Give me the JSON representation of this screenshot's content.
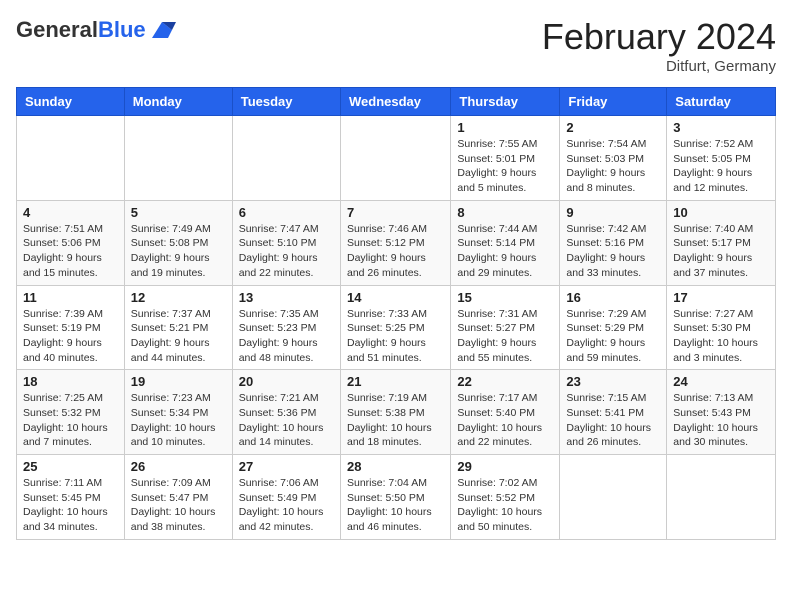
{
  "header": {
    "logo_general": "General",
    "logo_blue": "Blue",
    "month_title": "February 2024",
    "location": "Ditfurt, Germany"
  },
  "days_of_week": [
    "Sunday",
    "Monday",
    "Tuesday",
    "Wednesday",
    "Thursday",
    "Friday",
    "Saturday"
  ],
  "weeks": [
    [
      {
        "num": "",
        "info": ""
      },
      {
        "num": "",
        "info": ""
      },
      {
        "num": "",
        "info": ""
      },
      {
        "num": "",
        "info": ""
      },
      {
        "num": "1",
        "info": "Sunrise: 7:55 AM\nSunset: 5:01 PM\nDaylight: 9 hours and 5 minutes."
      },
      {
        "num": "2",
        "info": "Sunrise: 7:54 AM\nSunset: 5:03 PM\nDaylight: 9 hours and 8 minutes."
      },
      {
        "num": "3",
        "info": "Sunrise: 7:52 AM\nSunset: 5:05 PM\nDaylight: 9 hours and 12 minutes."
      }
    ],
    [
      {
        "num": "4",
        "info": "Sunrise: 7:51 AM\nSunset: 5:06 PM\nDaylight: 9 hours and 15 minutes."
      },
      {
        "num": "5",
        "info": "Sunrise: 7:49 AM\nSunset: 5:08 PM\nDaylight: 9 hours and 19 minutes."
      },
      {
        "num": "6",
        "info": "Sunrise: 7:47 AM\nSunset: 5:10 PM\nDaylight: 9 hours and 22 minutes."
      },
      {
        "num": "7",
        "info": "Sunrise: 7:46 AM\nSunset: 5:12 PM\nDaylight: 9 hours and 26 minutes."
      },
      {
        "num": "8",
        "info": "Sunrise: 7:44 AM\nSunset: 5:14 PM\nDaylight: 9 hours and 29 minutes."
      },
      {
        "num": "9",
        "info": "Sunrise: 7:42 AM\nSunset: 5:16 PM\nDaylight: 9 hours and 33 minutes."
      },
      {
        "num": "10",
        "info": "Sunrise: 7:40 AM\nSunset: 5:17 PM\nDaylight: 9 hours and 37 minutes."
      }
    ],
    [
      {
        "num": "11",
        "info": "Sunrise: 7:39 AM\nSunset: 5:19 PM\nDaylight: 9 hours and 40 minutes."
      },
      {
        "num": "12",
        "info": "Sunrise: 7:37 AM\nSunset: 5:21 PM\nDaylight: 9 hours and 44 minutes."
      },
      {
        "num": "13",
        "info": "Sunrise: 7:35 AM\nSunset: 5:23 PM\nDaylight: 9 hours and 48 minutes."
      },
      {
        "num": "14",
        "info": "Sunrise: 7:33 AM\nSunset: 5:25 PM\nDaylight: 9 hours and 51 minutes."
      },
      {
        "num": "15",
        "info": "Sunrise: 7:31 AM\nSunset: 5:27 PM\nDaylight: 9 hours and 55 minutes."
      },
      {
        "num": "16",
        "info": "Sunrise: 7:29 AM\nSunset: 5:29 PM\nDaylight: 9 hours and 59 minutes."
      },
      {
        "num": "17",
        "info": "Sunrise: 7:27 AM\nSunset: 5:30 PM\nDaylight: 10 hours and 3 minutes."
      }
    ],
    [
      {
        "num": "18",
        "info": "Sunrise: 7:25 AM\nSunset: 5:32 PM\nDaylight: 10 hours and 7 minutes."
      },
      {
        "num": "19",
        "info": "Sunrise: 7:23 AM\nSunset: 5:34 PM\nDaylight: 10 hours and 10 minutes."
      },
      {
        "num": "20",
        "info": "Sunrise: 7:21 AM\nSunset: 5:36 PM\nDaylight: 10 hours and 14 minutes."
      },
      {
        "num": "21",
        "info": "Sunrise: 7:19 AM\nSunset: 5:38 PM\nDaylight: 10 hours and 18 minutes."
      },
      {
        "num": "22",
        "info": "Sunrise: 7:17 AM\nSunset: 5:40 PM\nDaylight: 10 hours and 22 minutes."
      },
      {
        "num": "23",
        "info": "Sunrise: 7:15 AM\nSunset: 5:41 PM\nDaylight: 10 hours and 26 minutes."
      },
      {
        "num": "24",
        "info": "Sunrise: 7:13 AM\nSunset: 5:43 PM\nDaylight: 10 hours and 30 minutes."
      }
    ],
    [
      {
        "num": "25",
        "info": "Sunrise: 7:11 AM\nSunset: 5:45 PM\nDaylight: 10 hours and 34 minutes."
      },
      {
        "num": "26",
        "info": "Sunrise: 7:09 AM\nSunset: 5:47 PM\nDaylight: 10 hours and 38 minutes."
      },
      {
        "num": "27",
        "info": "Sunrise: 7:06 AM\nSunset: 5:49 PM\nDaylight: 10 hours and 42 minutes."
      },
      {
        "num": "28",
        "info": "Sunrise: 7:04 AM\nSunset: 5:50 PM\nDaylight: 10 hours and 46 minutes."
      },
      {
        "num": "29",
        "info": "Sunrise: 7:02 AM\nSunset: 5:52 PM\nDaylight: 10 hours and 50 minutes."
      },
      {
        "num": "",
        "info": ""
      },
      {
        "num": "",
        "info": ""
      }
    ]
  ]
}
